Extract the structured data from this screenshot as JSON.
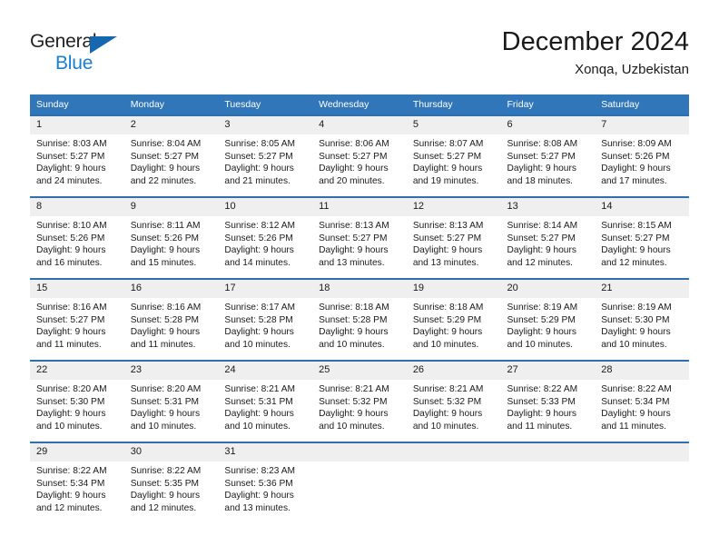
{
  "brand": {
    "name_top": "General",
    "name_bottom": "Blue",
    "triangle_color": "#1567b0",
    "blue_text_color": "#1a7fd4"
  },
  "header": {
    "title": "December 2024",
    "subtitle": "Xonqa, Uzbekistan"
  },
  "theme": {
    "header_background": "#3176b8",
    "row_border": "#2f6fae",
    "daynum_background": "#efefef",
    "text_color": "#1a1a1a"
  },
  "weekday_headers": [
    "Sunday",
    "Monday",
    "Tuesday",
    "Wednesday",
    "Thursday",
    "Friday",
    "Saturday"
  ],
  "weeks": [
    [
      {
        "day": "1",
        "sunrise": "Sunrise: 8:03 AM",
        "sunset": "Sunset: 5:27 PM",
        "daylight_1": "Daylight: 9 hours",
        "daylight_2": "and 24 minutes."
      },
      {
        "day": "2",
        "sunrise": "Sunrise: 8:04 AM",
        "sunset": "Sunset: 5:27 PM",
        "daylight_1": "Daylight: 9 hours",
        "daylight_2": "and 22 minutes."
      },
      {
        "day": "3",
        "sunrise": "Sunrise: 8:05 AM",
        "sunset": "Sunset: 5:27 PM",
        "daylight_1": "Daylight: 9 hours",
        "daylight_2": "and 21 minutes."
      },
      {
        "day": "4",
        "sunrise": "Sunrise: 8:06 AM",
        "sunset": "Sunset: 5:27 PM",
        "daylight_1": "Daylight: 9 hours",
        "daylight_2": "and 20 minutes."
      },
      {
        "day": "5",
        "sunrise": "Sunrise: 8:07 AM",
        "sunset": "Sunset: 5:27 PM",
        "daylight_1": "Daylight: 9 hours",
        "daylight_2": "and 19 minutes."
      },
      {
        "day": "6",
        "sunrise": "Sunrise: 8:08 AM",
        "sunset": "Sunset: 5:27 PM",
        "daylight_1": "Daylight: 9 hours",
        "daylight_2": "and 18 minutes."
      },
      {
        "day": "7",
        "sunrise": "Sunrise: 8:09 AM",
        "sunset": "Sunset: 5:26 PM",
        "daylight_1": "Daylight: 9 hours",
        "daylight_2": "and 17 minutes."
      }
    ],
    [
      {
        "day": "8",
        "sunrise": "Sunrise: 8:10 AM",
        "sunset": "Sunset: 5:26 PM",
        "daylight_1": "Daylight: 9 hours",
        "daylight_2": "and 16 minutes."
      },
      {
        "day": "9",
        "sunrise": "Sunrise: 8:11 AM",
        "sunset": "Sunset: 5:26 PM",
        "daylight_1": "Daylight: 9 hours",
        "daylight_2": "and 15 minutes."
      },
      {
        "day": "10",
        "sunrise": "Sunrise: 8:12 AM",
        "sunset": "Sunset: 5:26 PM",
        "daylight_1": "Daylight: 9 hours",
        "daylight_2": "and 14 minutes."
      },
      {
        "day": "11",
        "sunrise": "Sunrise: 8:13 AM",
        "sunset": "Sunset: 5:27 PM",
        "daylight_1": "Daylight: 9 hours",
        "daylight_2": "and 13 minutes."
      },
      {
        "day": "12",
        "sunrise": "Sunrise: 8:13 AM",
        "sunset": "Sunset: 5:27 PM",
        "daylight_1": "Daylight: 9 hours",
        "daylight_2": "and 13 minutes."
      },
      {
        "day": "13",
        "sunrise": "Sunrise: 8:14 AM",
        "sunset": "Sunset: 5:27 PM",
        "daylight_1": "Daylight: 9 hours",
        "daylight_2": "and 12 minutes."
      },
      {
        "day": "14",
        "sunrise": "Sunrise: 8:15 AM",
        "sunset": "Sunset: 5:27 PM",
        "daylight_1": "Daylight: 9 hours",
        "daylight_2": "and 12 minutes."
      }
    ],
    [
      {
        "day": "15",
        "sunrise": "Sunrise: 8:16 AM",
        "sunset": "Sunset: 5:27 PM",
        "daylight_1": "Daylight: 9 hours",
        "daylight_2": "and 11 minutes."
      },
      {
        "day": "16",
        "sunrise": "Sunrise: 8:16 AM",
        "sunset": "Sunset: 5:28 PM",
        "daylight_1": "Daylight: 9 hours",
        "daylight_2": "and 11 minutes."
      },
      {
        "day": "17",
        "sunrise": "Sunrise: 8:17 AM",
        "sunset": "Sunset: 5:28 PM",
        "daylight_1": "Daylight: 9 hours",
        "daylight_2": "and 10 minutes."
      },
      {
        "day": "18",
        "sunrise": "Sunrise: 8:18 AM",
        "sunset": "Sunset: 5:28 PM",
        "daylight_1": "Daylight: 9 hours",
        "daylight_2": "and 10 minutes."
      },
      {
        "day": "19",
        "sunrise": "Sunrise: 8:18 AM",
        "sunset": "Sunset: 5:29 PM",
        "daylight_1": "Daylight: 9 hours",
        "daylight_2": "and 10 minutes."
      },
      {
        "day": "20",
        "sunrise": "Sunrise: 8:19 AM",
        "sunset": "Sunset: 5:29 PM",
        "daylight_1": "Daylight: 9 hours",
        "daylight_2": "and 10 minutes."
      },
      {
        "day": "21",
        "sunrise": "Sunrise: 8:19 AM",
        "sunset": "Sunset: 5:30 PM",
        "daylight_1": "Daylight: 9 hours",
        "daylight_2": "and 10 minutes."
      }
    ],
    [
      {
        "day": "22",
        "sunrise": "Sunrise: 8:20 AM",
        "sunset": "Sunset: 5:30 PM",
        "daylight_1": "Daylight: 9 hours",
        "daylight_2": "and 10 minutes."
      },
      {
        "day": "23",
        "sunrise": "Sunrise: 8:20 AM",
        "sunset": "Sunset: 5:31 PM",
        "daylight_1": "Daylight: 9 hours",
        "daylight_2": "and 10 minutes."
      },
      {
        "day": "24",
        "sunrise": "Sunrise: 8:21 AM",
        "sunset": "Sunset: 5:31 PM",
        "daylight_1": "Daylight: 9 hours",
        "daylight_2": "and 10 minutes."
      },
      {
        "day": "25",
        "sunrise": "Sunrise: 8:21 AM",
        "sunset": "Sunset: 5:32 PM",
        "daylight_1": "Daylight: 9 hours",
        "daylight_2": "and 10 minutes."
      },
      {
        "day": "26",
        "sunrise": "Sunrise: 8:21 AM",
        "sunset": "Sunset: 5:32 PM",
        "daylight_1": "Daylight: 9 hours",
        "daylight_2": "and 10 minutes."
      },
      {
        "day": "27",
        "sunrise": "Sunrise: 8:22 AM",
        "sunset": "Sunset: 5:33 PM",
        "daylight_1": "Daylight: 9 hours",
        "daylight_2": "and 11 minutes."
      },
      {
        "day": "28",
        "sunrise": "Sunrise: 8:22 AM",
        "sunset": "Sunset: 5:34 PM",
        "daylight_1": "Daylight: 9 hours",
        "daylight_2": "and 11 minutes."
      }
    ],
    [
      {
        "day": "29",
        "sunrise": "Sunrise: 8:22 AM",
        "sunset": "Sunset: 5:34 PM",
        "daylight_1": "Daylight: 9 hours",
        "daylight_2": "and 12 minutes."
      },
      {
        "day": "30",
        "sunrise": "Sunrise: 8:22 AM",
        "sunset": "Sunset: 5:35 PM",
        "daylight_1": "Daylight: 9 hours",
        "daylight_2": "and 12 minutes."
      },
      {
        "day": "31",
        "sunrise": "Sunrise: 8:23 AM",
        "sunset": "Sunset: 5:36 PM",
        "daylight_1": "Daylight: 9 hours",
        "daylight_2": "and 13 minutes."
      },
      {
        "day": "",
        "sunrise": "",
        "sunset": "",
        "daylight_1": "",
        "daylight_2": ""
      },
      {
        "day": "",
        "sunrise": "",
        "sunset": "",
        "daylight_1": "",
        "daylight_2": ""
      },
      {
        "day": "",
        "sunrise": "",
        "sunset": "",
        "daylight_1": "",
        "daylight_2": ""
      },
      {
        "day": "",
        "sunrise": "",
        "sunset": "",
        "daylight_1": "",
        "daylight_2": ""
      }
    ]
  ]
}
